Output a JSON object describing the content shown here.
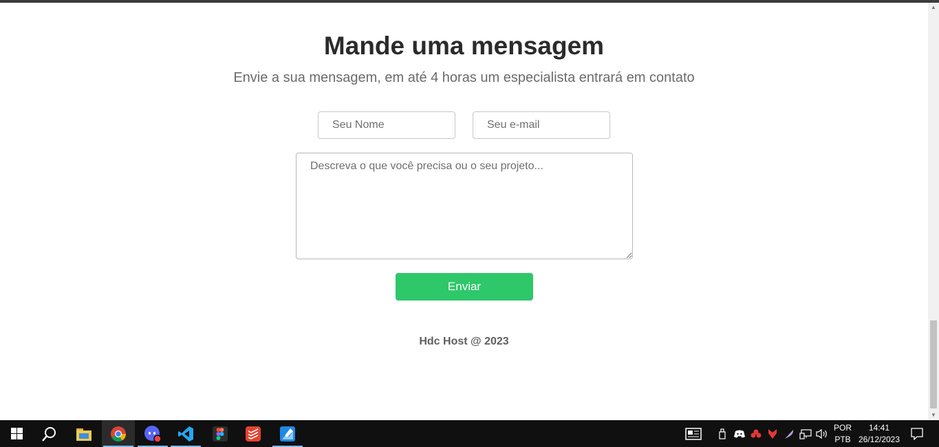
{
  "contact": {
    "title": "Mande uma mensagem",
    "subtitle": "Envie a sua mensagem, em até 4 horas um especialista entrará em contato",
    "name_placeholder": "Seu Nome",
    "email_placeholder": "Seu e-mail",
    "message_placeholder": "Descreva o que você precisa ou o seu projeto...",
    "submit_label": "Enviar"
  },
  "footer": {
    "text": "Hdc Host @ 2023"
  },
  "taskbar": {
    "apps": [
      "start-icon",
      "search-icon",
      "file-explorer-icon",
      "chrome-icon",
      "discord-icon",
      "vscode-icon",
      "figma-icon",
      "todoist-icon",
      "paint-icon"
    ],
    "language": "POR",
    "layout": "PTB",
    "time": "14:41",
    "date": "26/12/2023"
  },
  "colors": {
    "accent": "#2ec76a",
    "title": "#2b2b2b",
    "subtitle": "#6b6b6b"
  }
}
